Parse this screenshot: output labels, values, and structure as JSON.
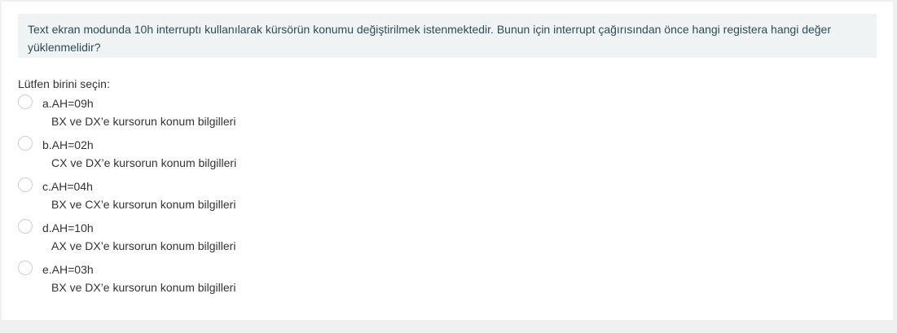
{
  "question": {
    "text": "Text ekran modunda 10h interruptı kullanılarak kürsörün konumu değiştirilmek istenmektedir. Bunun için interrupt çağırısından önce hangi registera hangi değer yüklenmelidir?"
  },
  "prompt": "Lütfen birini seçin:",
  "options": [
    {
      "label": "a.AH=09h",
      "desc": "BX ve DX’e kursorun konum bilgilleri"
    },
    {
      "label": "b.AH=02h",
      "desc": "CX ve DX’e kursorun konum bilgilleri"
    },
    {
      "label": "c.AH=04h",
      "desc": "BX ve CX’e kursorun konum bilgilleri"
    },
    {
      "label": "d.AH=10h",
      "desc": "AX ve DX’e kursorun konum bilgilleri"
    },
    {
      "label": "e.AH=03h",
      "desc": "BX ve DX’e kursorun konum bilgilleri"
    }
  ]
}
